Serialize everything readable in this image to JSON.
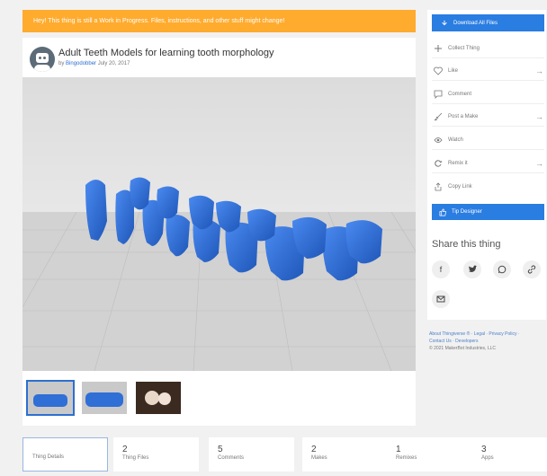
{
  "banner": "Hey! This thing is still a Work in Progress. Files, instructions, and other stuff might change!",
  "thing": {
    "title": "Adult Teeth Models for learning tooth morphology",
    "by": "by",
    "author": "Bingodobber",
    "date": "July 20, 2017"
  },
  "actions": {
    "download": "Download All Files",
    "collect": "Collect Thing",
    "like": "Like",
    "comment": "Comment",
    "post_make": "Post a Make",
    "watch": "Watch",
    "remix": "Remix it",
    "copy_link": "Copy Link",
    "tip": "Tip Designer"
  },
  "share": {
    "title": "Share this thing",
    "icons": [
      "facebook-icon",
      "twitter-icon",
      "whatsapp-icon",
      "link-icon",
      "email-icon"
    ]
  },
  "footer": {
    "line1": "About Thingiverse ® · Legal · Privacy Policy ·",
    "line2": "Contact Us · Developers",
    "copyright": "© 2021 MakerBot Industries, LLC"
  },
  "tabs": [
    {
      "count": "",
      "label": "Thing Details"
    },
    {
      "count": "2",
      "label": "Thing Files"
    },
    {
      "count": "5",
      "label": "Comments"
    },
    {
      "count": "2",
      "label": "Makes"
    },
    {
      "count": "1",
      "label": "Remixes"
    },
    {
      "count": "3",
      "label": "Apps"
    }
  ],
  "colors": {
    "accent": "#2a7de1",
    "banner": "#ffab2e",
    "teeth": "#2f6fd6"
  }
}
